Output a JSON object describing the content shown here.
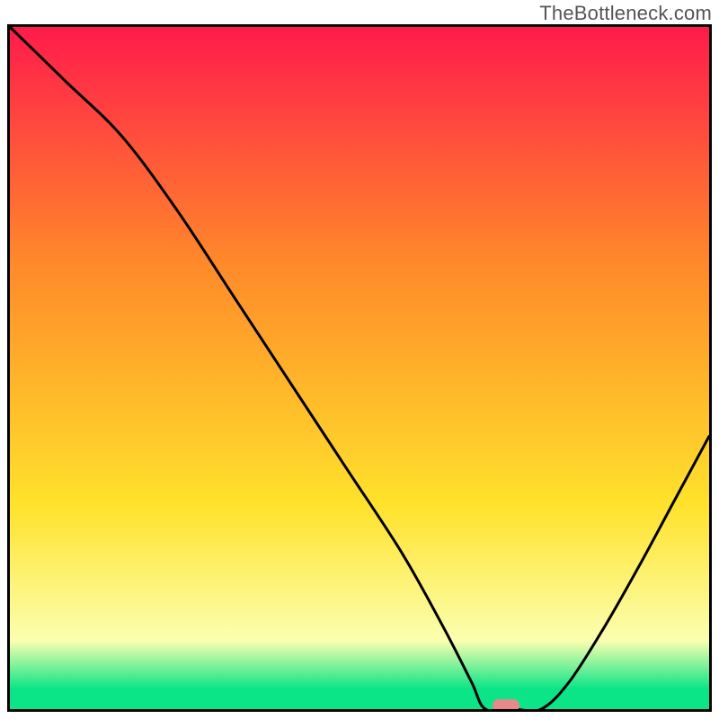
{
  "watermark": "TheBottleneck.com",
  "colors": {
    "grad_red": "#ff1b4b",
    "grad_orange": "#ff8a2a",
    "grad_yellow": "#ffe22b",
    "grad_pale": "#fbffb0",
    "grad_green": "#0be587",
    "curve": "#000000",
    "marker": "#e58a88",
    "frame": "#000000"
  },
  "chart_data": {
    "type": "line",
    "title": "",
    "xlabel": "",
    "ylabel": "",
    "xlim": [
      0,
      100
    ],
    "ylim": [
      0,
      100
    ],
    "x": [
      0,
      8,
      16,
      24,
      32,
      40,
      48,
      56,
      62,
      66,
      68,
      72,
      76,
      80,
      85,
      90,
      95,
      100
    ],
    "values": [
      100,
      92,
      84,
      73,
      60.5,
      48,
      35.5,
      23,
      12,
      4,
      0,
      0,
      0,
      4,
      12,
      21,
      30.5,
      40
    ],
    "marker": {
      "x": 71,
      "y": 0
    },
    "background_gradient_stops": [
      {
        "pct": 0,
        "color": "#ff1b4b"
      },
      {
        "pct": 35,
        "color": "#ff8a2a"
      },
      {
        "pct": 70,
        "color": "#ffe22b"
      },
      {
        "pct": 90,
        "color": "#fbffb0"
      },
      {
        "pct": 97,
        "color": "#0be587"
      },
      {
        "pct": 100,
        "color": "#0be587"
      }
    ]
  }
}
